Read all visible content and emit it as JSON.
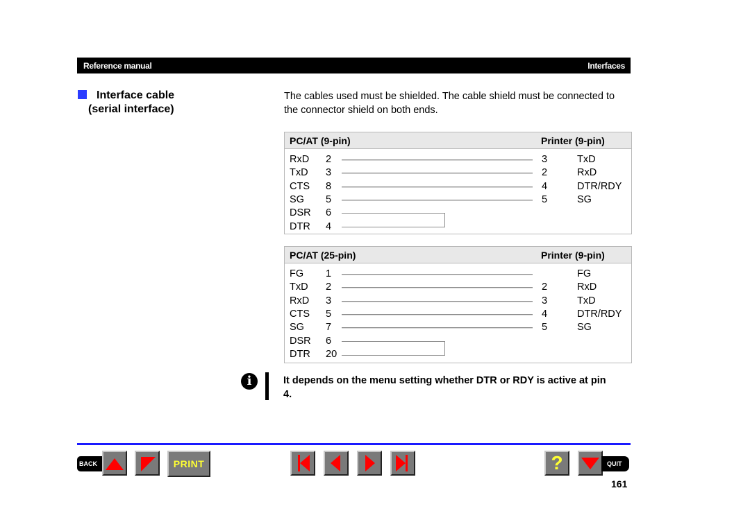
{
  "header": {
    "left": "Reference manual",
    "right": "Interfaces"
  },
  "section": {
    "title_line1": "Interface cable",
    "title_line2": "(serial interface)"
  },
  "intro": "The cables used must be shielded. The cable shield must be connected to the connector shield on both ends.",
  "tables": [
    {
      "left_header": "PC/AT (9-pin)",
      "right_header": "Printer (9-pin)",
      "rows": [
        {
          "sig": "RxD",
          "pin": "2",
          "rpin": "3",
          "rsig": "TxD",
          "wire": "straight"
        },
        {
          "sig": "TxD",
          "pin": "3",
          "rpin": "2",
          "rsig": "RxD",
          "wire": "straight"
        },
        {
          "sig": "CTS",
          "pin": "8",
          "rpin": "4",
          "rsig": "DTR/RDY",
          "wire": "straight"
        },
        {
          "sig": "SG",
          "pin": "5",
          "rpin": "5",
          "rsig": "SG",
          "wire": "straight"
        },
        {
          "sig": "DSR",
          "pin": "6",
          "rpin": "",
          "rsig": "",
          "wire": "loop"
        },
        {
          "sig": "DTR",
          "pin": "4",
          "rpin": "",
          "rsig": "",
          "wire": "loop"
        }
      ]
    },
    {
      "left_header": "PC/AT (25-pin)",
      "right_header": "Printer (9-pin)",
      "rows": [
        {
          "sig": "FG",
          "pin": "1",
          "rpin": "",
          "rsig": "FG",
          "wire": "straight"
        },
        {
          "sig": "TxD",
          "pin": "2",
          "rpin": "2",
          "rsig": "RxD",
          "wire": "straight"
        },
        {
          "sig": "RxD",
          "pin": "3",
          "rpin": "3",
          "rsig": "TxD",
          "wire": "straight"
        },
        {
          "sig": "CTS",
          "pin": "5",
          "rpin": "4",
          "rsig": "DTR/RDY",
          "wire": "straight"
        },
        {
          "sig": "SG",
          "pin": "7",
          "rpin": "5",
          "rsig": "SG",
          "wire": "straight"
        },
        {
          "sig": "DSR",
          "pin": "6",
          "rpin": "",
          "rsig": "",
          "wire": "loop"
        },
        {
          "sig": "DTR",
          "pin": "20",
          "rpin": "",
          "rsig": "",
          "wire": "loop"
        }
      ]
    }
  ],
  "note": {
    "icon": "info-icon",
    "text": "It depends on the menu setting whether DTR or RDY is active at pin 4."
  },
  "nav": {
    "back_label": "BACK",
    "print_label": "PRINT",
    "help_label": "?",
    "quit_label": "QUIT",
    "icons": [
      "up-triangle-icon",
      "down-corner-icon",
      "first-page-icon",
      "prev-page-icon",
      "next-page-icon",
      "last-page-icon",
      "down-triangle-icon"
    ]
  },
  "colors": {
    "accent_blue": "#2b3cff",
    "rule_blue": "#1a1aff",
    "button_gray": "#7a7a7a",
    "arrow_red": "#ff0000",
    "print_yellow": "#ffff33"
  },
  "page_number": "161"
}
